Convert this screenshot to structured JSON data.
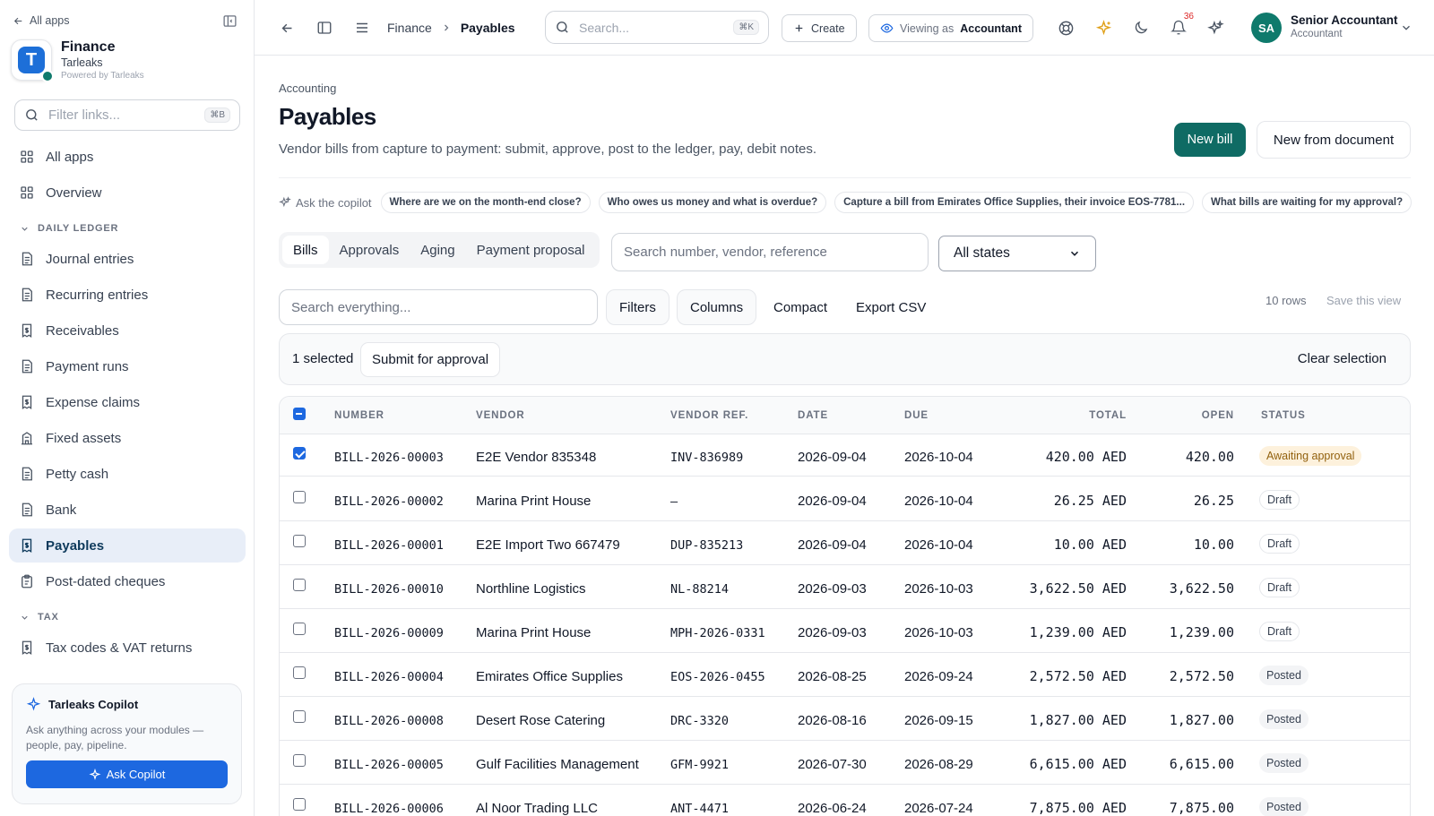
{
  "sidebar": {
    "back_label": "All apps",
    "brand": {
      "name": "Finance",
      "company": "Tarleaks",
      "powered": "Powered by Tarleaks",
      "logo_letter": "T"
    },
    "filter": {
      "placeholder": "Filter links...",
      "shortcut": "⌘B"
    },
    "top_items": [
      {
        "label": "All apps",
        "icon": "grid-icon"
      },
      {
        "label": "Overview",
        "icon": "grid-icon"
      }
    ],
    "sections": [
      {
        "label": "DAILY LEDGER",
        "items": [
          {
            "label": "Journal entries",
            "icon": "document-icon"
          },
          {
            "label": "Recurring entries",
            "icon": "document-icon"
          },
          {
            "label": "Receivables",
            "icon": "receipt-icon"
          },
          {
            "label": "Payment runs",
            "icon": "document-icon"
          },
          {
            "label": "Expense claims",
            "icon": "receipt-icon"
          },
          {
            "label": "Fixed assets",
            "icon": "building-icon"
          },
          {
            "label": "Petty cash",
            "icon": "document-icon"
          },
          {
            "label": "Bank",
            "icon": "document-icon"
          },
          {
            "label": "Payables",
            "icon": "receipt-icon",
            "active": true
          },
          {
            "label": "Post-dated cheques",
            "icon": "clipboard-icon"
          }
        ]
      },
      {
        "label": "TAX",
        "items": [
          {
            "label": "Tax codes & VAT returns",
            "icon": "receipt-icon"
          }
        ]
      }
    ],
    "copilot": {
      "title": "Tarleaks Copilot",
      "description": "Ask anything across your modules — people, pay, pipeline.",
      "button": "Ask Copilot"
    }
  },
  "topbar": {
    "breadcrumb": [
      "Finance",
      "Payables"
    ],
    "search": {
      "placeholder": "Search...",
      "shortcut": "⌘K"
    },
    "create_label": "Create",
    "viewing_prefix": "Viewing as",
    "viewing_role": "Accountant",
    "notification_count": "36",
    "user": {
      "initials": "SA",
      "name": "Senior Accountant",
      "role": "Accountant"
    }
  },
  "page": {
    "eyebrow": "Accounting",
    "title": "Payables",
    "description": "Vendor bills from capture to payment: submit, approve, post to the ledger, pay, debit notes.",
    "new_bill": "New bill",
    "new_from_document": "New from document",
    "copilot_label": "Ask the copilot",
    "suggestions": [
      "Where are we on the month-end close?",
      "Who owes us money and what is overdue?",
      "Capture a bill from Emirates Office Supplies, their invoice EOS-7781...",
      "What bills are waiting for my approval?"
    ],
    "tabs": [
      "Bills",
      "Approvals",
      "Aging",
      "Payment proposal"
    ],
    "active_tab": 0,
    "filter_search_placeholder": "Search number, vendor, reference",
    "state_select": "All states",
    "toolbar": {
      "search_placeholder": "Search everything...",
      "filters": "Filters",
      "columns": "Columns",
      "compact": "Compact",
      "export": "Export CSV",
      "rows": "10 rows",
      "save_view": "Save this view"
    },
    "selection": {
      "count": "1 selected",
      "submit": "Submit for approval",
      "clear": "Clear selection"
    }
  },
  "table": {
    "columns": [
      "NUMBER",
      "VENDOR",
      "VENDOR REF.",
      "DATE",
      "DUE",
      "TOTAL",
      "OPEN",
      "STATUS"
    ],
    "rows": [
      {
        "checked": true,
        "number": "BILL-2026-00003",
        "vendor": "E2E Vendor 835348",
        "ref": "INV-836989",
        "date": "2026-09-04",
        "due": "2026-10-04",
        "total": "420.00 AED",
        "open": "420.00",
        "status": "Awaiting approval",
        "status_kind": "await"
      },
      {
        "checked": false,
        "number": "BILL-2026-00002",
        "vendor": "Marina Print House",
        "ref": "—",
        "date": "2026-09-04",
        "due": "2026-10-04",
        "total": "26.25 AED",
        "open": "26.25",
        "status": "Draft",
        "status_kind": "draft"
      },
      {
        "checked": false,
        "number": "BILL-2026-00001",
        "vendor": "E2E Import Two 667479",
        "ref": "DUP-835213",
        "date": "2026-09-04",
        "due": "2026-10-04",
        "total": "10.00 AED",
        "open": "10.00",
        "status": "Draft",
        "status_kind": "draft"
      },
      {
        "checked": false,
        "number": "BILL-2026-00010",
        "vendor": "Northline Logistics",
        "ref": "NL-88214",
        "date": "2026-09-03",
        "due": "2026-10-03",
        "total": "3,622.50 AED",
        "open": "3,622.50",
        "status": "Draft",
        "status_kind": "draft"
      },
      {
        "checked": false,
        "number": "BILL-2026-00009",
        "vendor": "Marina Print House",
        "ref": "MPH-2026-0331",
        "date": "2026-09-03",
        "due": "2026-10-03",
        "total": "1,239.00 AED",
        "open": "1,239.00",
        "status": "Draft",
        "status_kind": "draft"
      },
      {
        "checked": false,
        "number": "BILL-2026-00004",
        "vendor": "Emirates Office Supplies",
        "ref": "EOS-2026-0455",
        "date": "2026-08-25",
        "due": "2026-09-24",
        "total": "2,572.50 AED",
        "open": "2,572.50",
        "status": "Posted",
        "status_kind": "posted"
      },
      {
        "checked": false,
        "number": "BILL-2026-00008",
        "vendor": "Desert Rose Catering",
        "ref": "DRC-3320",
        "date": "2026-08-16",
        "due": "2026-09-15",
        "total": "1,827.00 AED",
        "open": "1,827.00",
        "status": "Posted",
        "status_kind": "posted"
      },
      {
        "checked": false,
        "number": "BILL-2026-00005",
        "vendor": "Gulf Facilities Management",
        "ref": "GFM-9921",
        "date": "2026-07-30",
        "due": "2026-08-29",
        "total": "6,615.00 AED",
        "open": "6,615.00",
        "status": "Posted",
        "status_kind": "posted"
      },
      {
        "checked": false,
        "number": "BILL-2026-00006",
        "vendor": "Al Noor Trading LLC",
        "ref": "ANT-4471",
        "date": "2026-06-24",
        "due": "2026-07-24",
        "total": "7,875.00 AED",
        "open": "7,875.00",
        "status": "Posted",
        "status_kind": "posted"
      }
    ]
  }
}
